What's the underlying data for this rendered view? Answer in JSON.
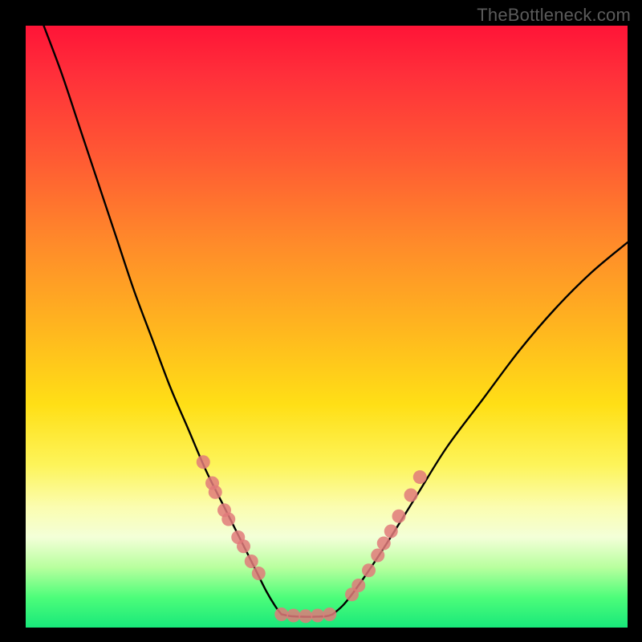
{
  "watermark": "TheBottleneck.com",
  "chart_data": {
    "type": "line",
    "title": "",
    "xlabel": "",
    "ylabel": "",
    "xlim": [
      0,
      100
    ],
    "ylim": [
      0,
      100
    ],
    "grid": false,
    "legend": false,
    "notes": "Axes are unitless percentages estimated from pixel position (0 = left/bottom, 100 = right/top). No tick labels appear in the image.",
    "series": [
      {
        "name": "left-curve",
        "color": "#000000",
        "x": [
          3,
          6,
          9,
          12,
          15,
          18,
          21,
          24,
          27,
          30,
          33,
          36,
          38,
          40,
          41.5,
          42.5
        ],
        "y": [
          100,
          92,
          83,
          74,
          65,
          56,
          48,
          40,
          33,
          26,
          20,
          14,
          10,
          6,
          3.5,
          2.2
        ]
      },
      {
        "name": "right-curve",
        "color": "#000000",
        "x": [
          51,
          53,
          56,
          60,
          65,
          70,
          76,
          82,
          88,
          94,
          100
        ],
        "y": [
          2.2,
          4,
          8,
          14,
          22,
          30,
          38,
          46,
          53,
          59,
          64
        ]
      },
      {
        "name": "flat-bottom",
        "color": "#000000",
        "x": [
          42.5,
          44,
          46,
          48,
          50,
          51
        ],
        "y": [
          2.2,
          1.9,
          1.8,
          1.8,
          1.9,
          2.2
        ]
      },
      {
        "name": "dots-left-arm",
        "color": "#e07a7a",
        "type": "scatter",
        "x": [
          29.5,
          31,
          31.5,
          33,
          33.7,
          35.3,
          36.2,
          37.5,
          38.7
        ],
        "y": [
          27.5,
          24,
          22.5,
          19.5,
          18,
          15,
          13.5,
          11,
          9
        ]
      },
      {
        "name": "dots-bottom",
        "color": "#e07a7a",
        "type": "scatter",
        "x": [
          42.5,
          44.5,
          46.5,
          48.5,
          50.5
        ],
        "y": [
          2.2,
          2.0,
          1.9,
          2.0,
          2.2
        ]
      },
      {
        "name": "dots-right-arm",
        "color": "#e07a7a",
        "type": "scatter",
        "x": [
          54.2,
          55.3,
          57,
          58.5,
          59.5,
          60.7,
          62,
          64,
          65.5
        ],
        "y": [
          5.5,
          7,
          9.5,
          12,
          14,
          16,
          18.5,
          22,
          25
        ]
      }
    ]
  }
}
